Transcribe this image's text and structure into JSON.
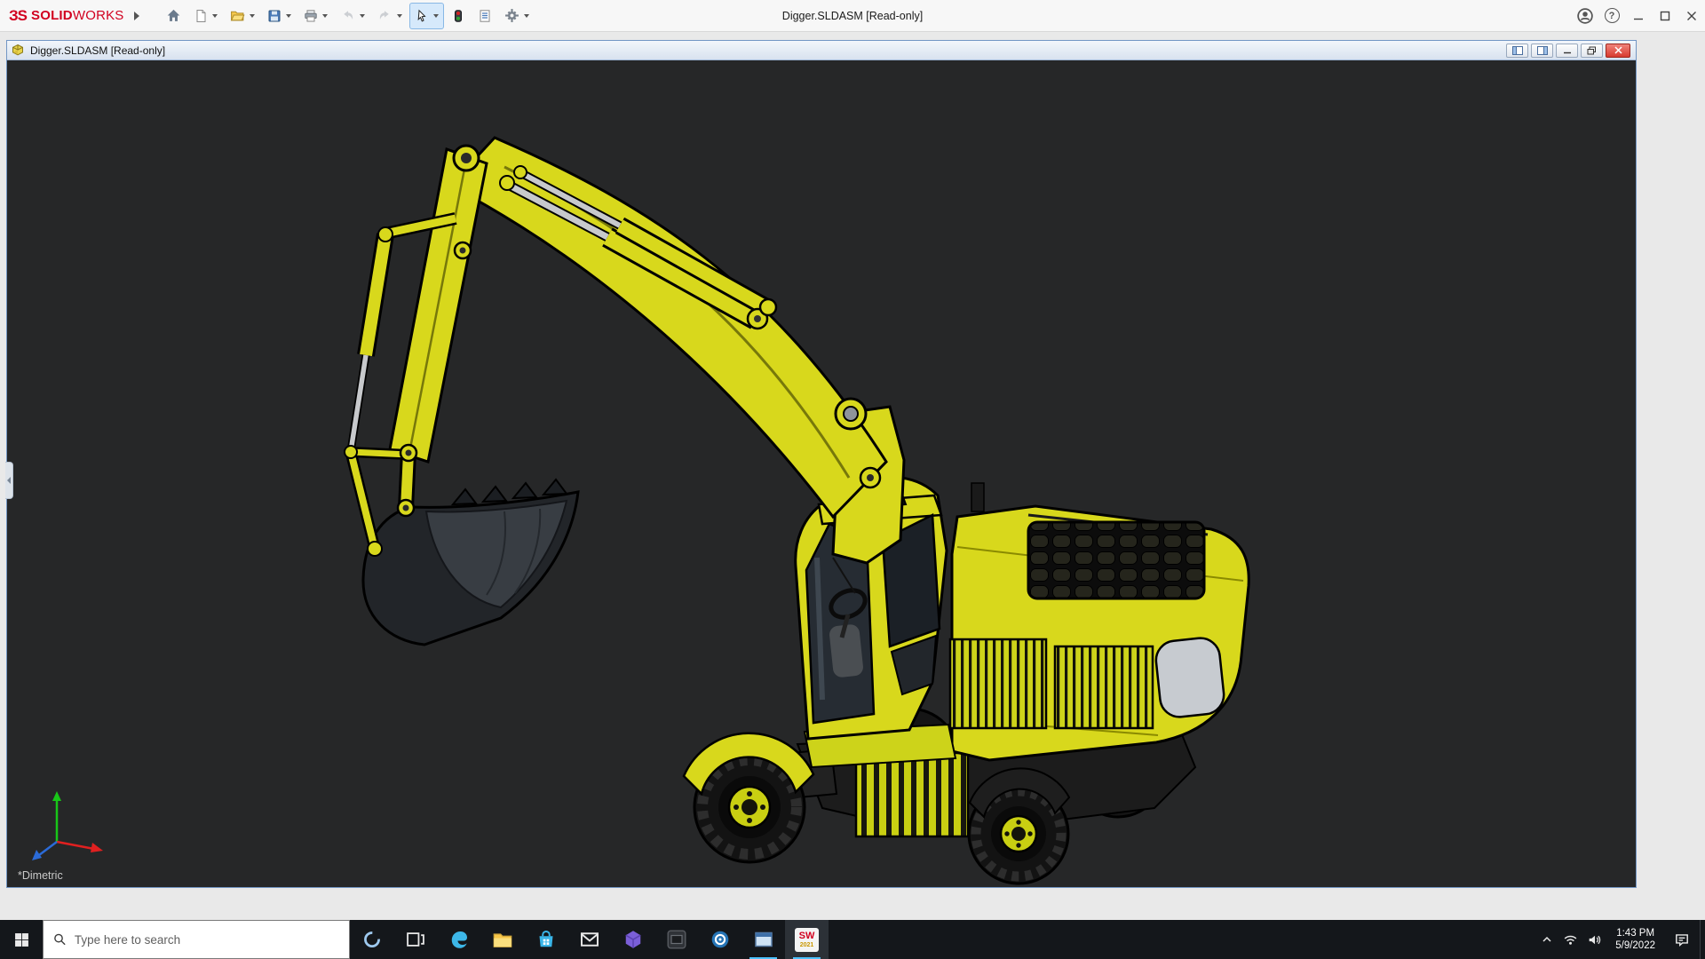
{
  "app": {
    "logo_mark": "ЗS",
    "brand_bold": "SOLID",
    "brand_light": "WORKS",
    "window_title": "Digger.SLDASM [Read-only]",
    "help_glyph": "?"
  },
  "toolbar": {
    "icons": [
      "home",
      "new-document",
      "open",
      "save",
      "print",
      "undo",
      "redo",
      "select",
      "rebuild",
      "file-properties",
      "options"
    ],
    "disabled": [
      "undo",
      "redo"
    ],
    "active": "select"
  },
  "document": {
    "title": "Digger.SLDASM [Read-only]",
    "view_orientation": "*Dimetric"
  },
  "taskbar": {
    "search_placeholder": "Type here to search",
    "pinned_icons": [
      "start",
      "cortana",
      "task-view",
      "edge",
      "file-explorer",
      "store",
      "mail",
      "3d-viewer",
      "capture-tool",
      "cad-tool",
      "window-app",
      "solidworks-2021"
    ],
    "solidworks_label": "SW",
    "solidworks_badge": "2021",
    "tray_icons": [
      "tray-expand",
      "network",
      "volume",
      "action-center"
    ],
    "clock_time": "1:43 PM",
    "clock_date": "5/9/2022"
  },
  "colors": {
    "viewport_background": "#262728",
    "excavator_yellow": "#d8d81c",
    "brand_red": "#d1001f",
    "doc_close_red": "#d83a30",
    "taskbar_background": "#14171b",
    "doc_titlebar": "#d8e2ef"
  }
}
